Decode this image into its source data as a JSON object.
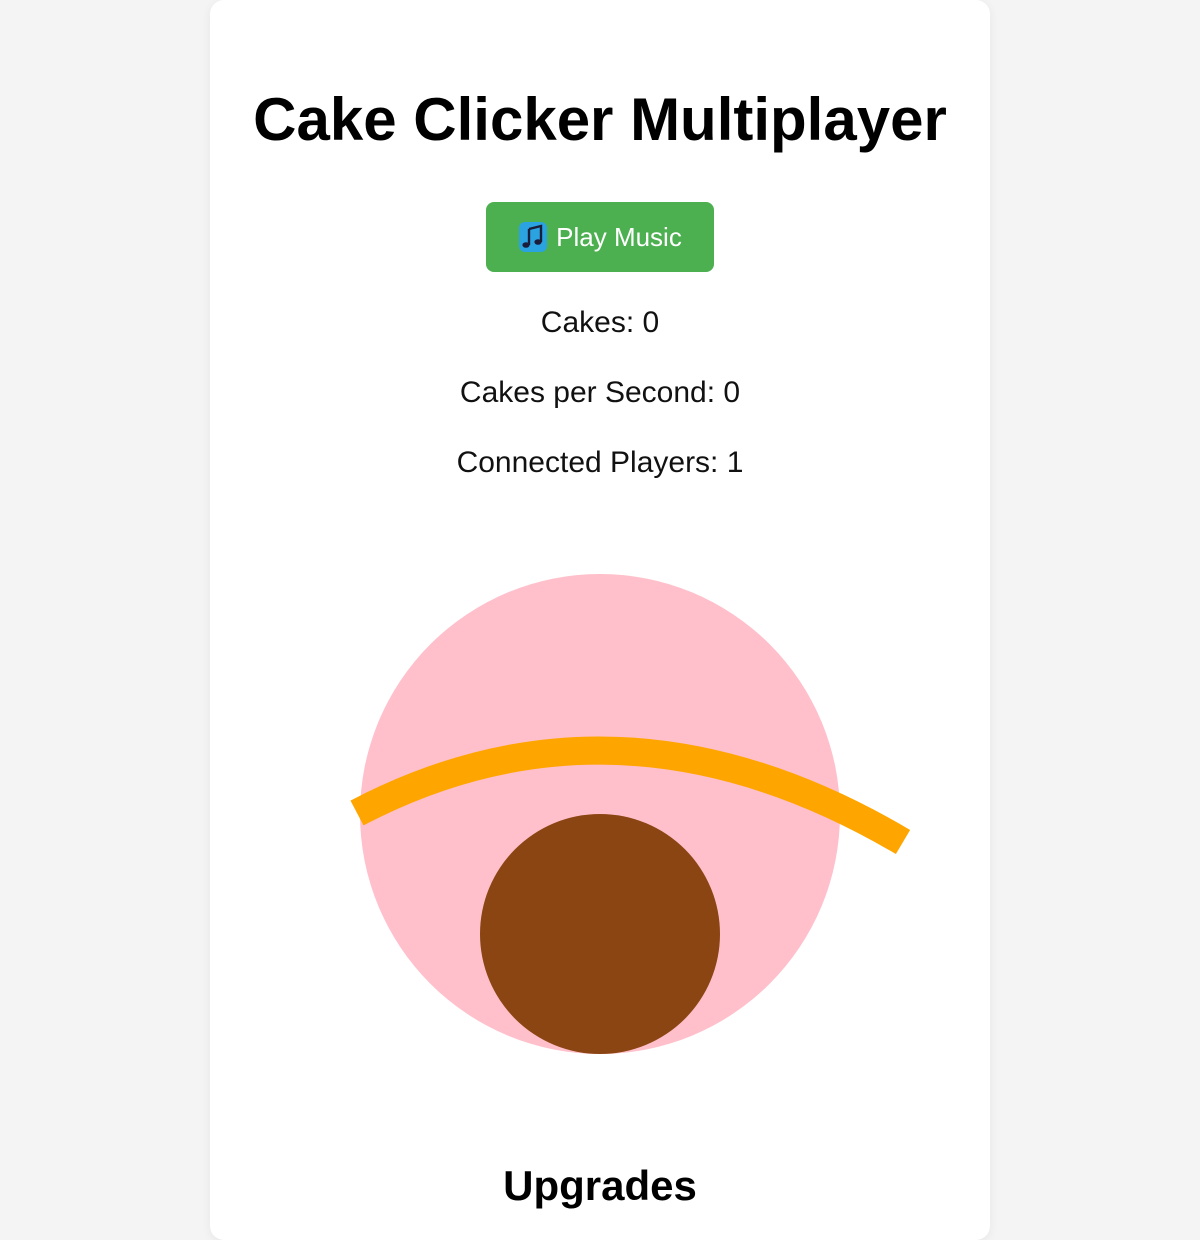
{
  "app": {
    "title": "Cake Clicker Multiplayer"
  },
  "controls": {
    "music_button_label": "Play Music",
    "music_icon": "music-note-icon"
  },
  "stats": {
    "cakes_label": "Cakes: 0",
    "cakes_value": 0,
    "cps_label": "Cakes per Second: 0",
    "cps_value": 0,
    "players_label": "Connected Players: 1",
    "players_value": 1
  },
  "cake": {
    "body_color": "#ffc0cb",
    "frosting_color": "#ffa500",
    "chocolate_color": "#8b4513"
  },
  "sections": {
    "upgrades_heading": "Upgrades"
  },
  "theme": {
    "accent": "#4caf50",
    "background": "#f4f4f4",
    "card": "#ffffff"
  }
}
